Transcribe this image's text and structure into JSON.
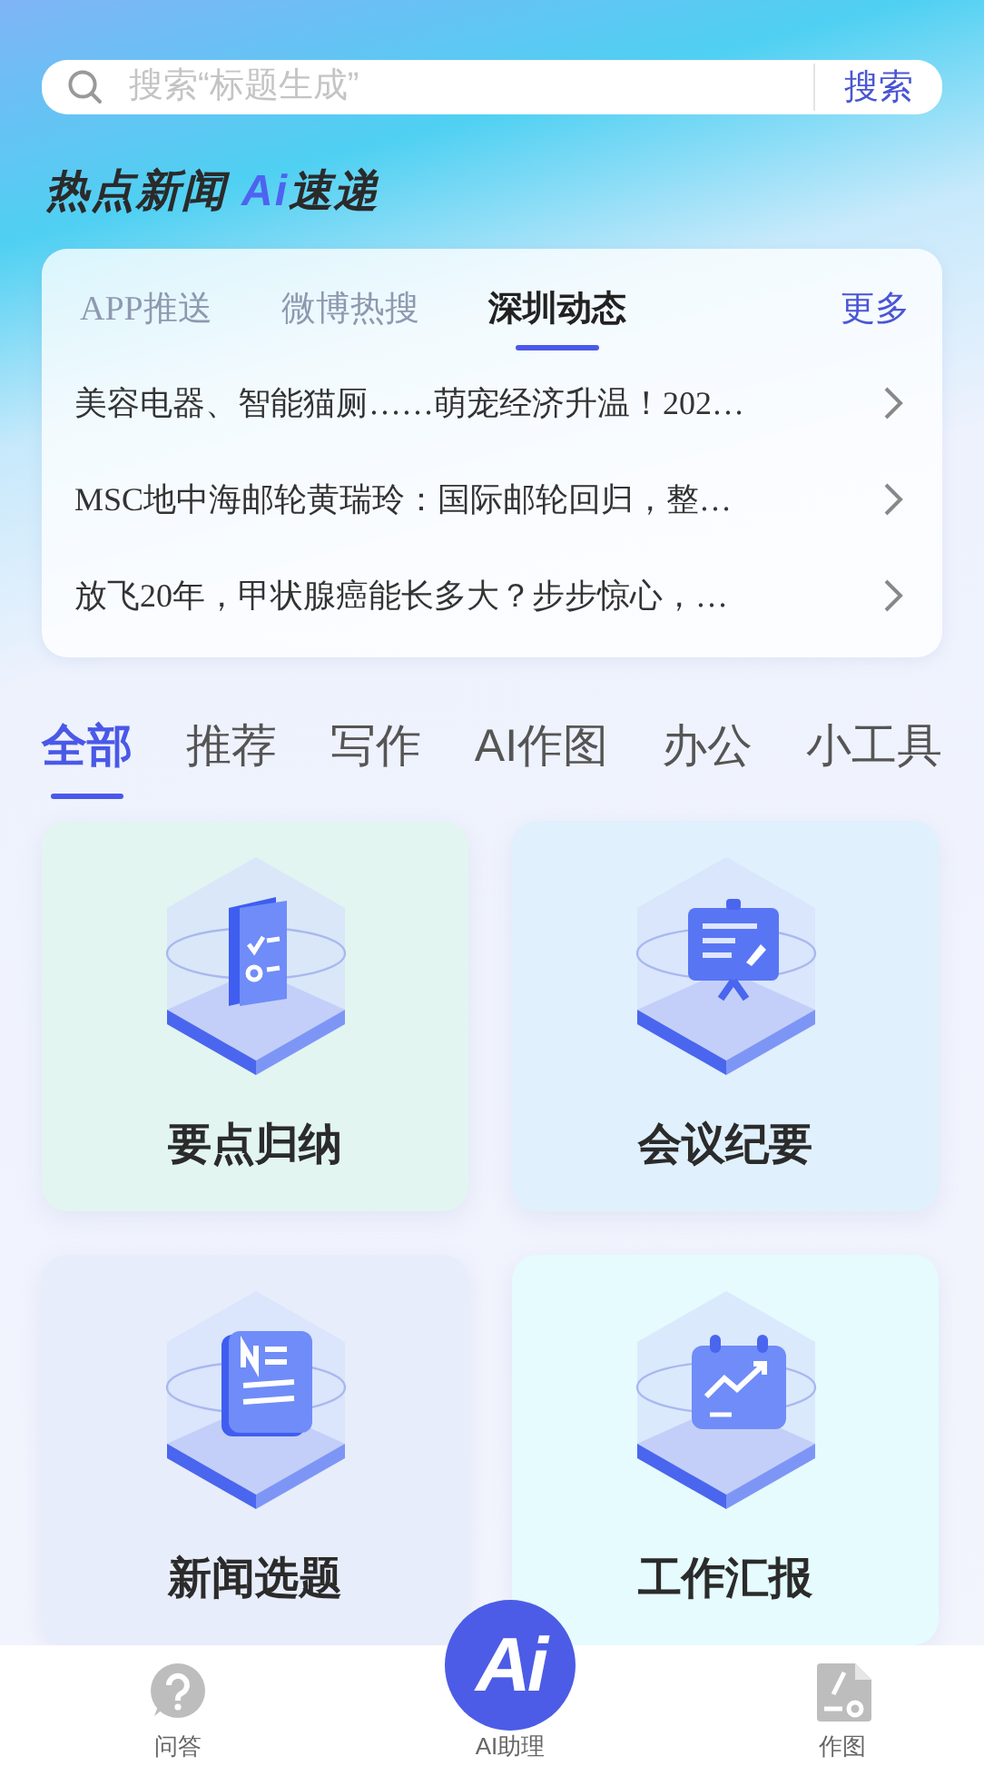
{
  "search": {
    "placeholder": "搜索“标题生成”",
    "button": "搜索"
  },
  "heading": {
    "text": "热点新闻",
    "accent": "Ai",
    "suffix": "速递"
  },
  "news": {
    "tabs": [
      {
        "label": "APP推送",
        "selected": false
      },
      {
        "label": "微博热搜",
        "selected": false
      },
      {
        "label": "深圳动态",
        "selected": true
      }
    ],
    "more": "更多",
    "items": [
      "美容电器、智能猫厕……萌宠经济升温！202…",
      "MSC地中海邮轮黄瑞玲：国际邮轮回归，整…",
      "放飞20年，甲状腺癌能长多大？步步惊心，…"
    ]
  },
  "categories": [
    {
      "label": "全部",
      "selected": true
    },
    {
      "label": "推荐",
      "selected": false
    },
    {
      "label": "写作",
      "selected": false
    },
    {
      "label": "AI作图",
      "selected": false
    },
    {
      "label": "办公",
      "selected": false
    },
    {
      "label": "小工具",
      "selected": false
    }
  ],
  "tools": [
    {
      "title": "要点归纳",
      "kind": "checklist",
      "color": "#e2f5f1"
    },
    {
      "title": "会议纪要",
      "kind": "presentation",
      "color": "#e0f0fd"
    },
    {
      "title": "新闻选题",
      "kind": "news",
      "color": "#e8edfb"
    },
    {
      "title": "工作汇报",
      "kind": "chart",
      "color": "#e5fbfd"
    }
  ],
  "tabbar": [
    {
      "label": "问答",
      "kind": "question"
    },
    {
      "label": "AI助理",
      "kind": "ai",
      "logo": "Ai"
    },
    {
      "label": "作图",
      "kind": "draw"
    }
  ]
}
